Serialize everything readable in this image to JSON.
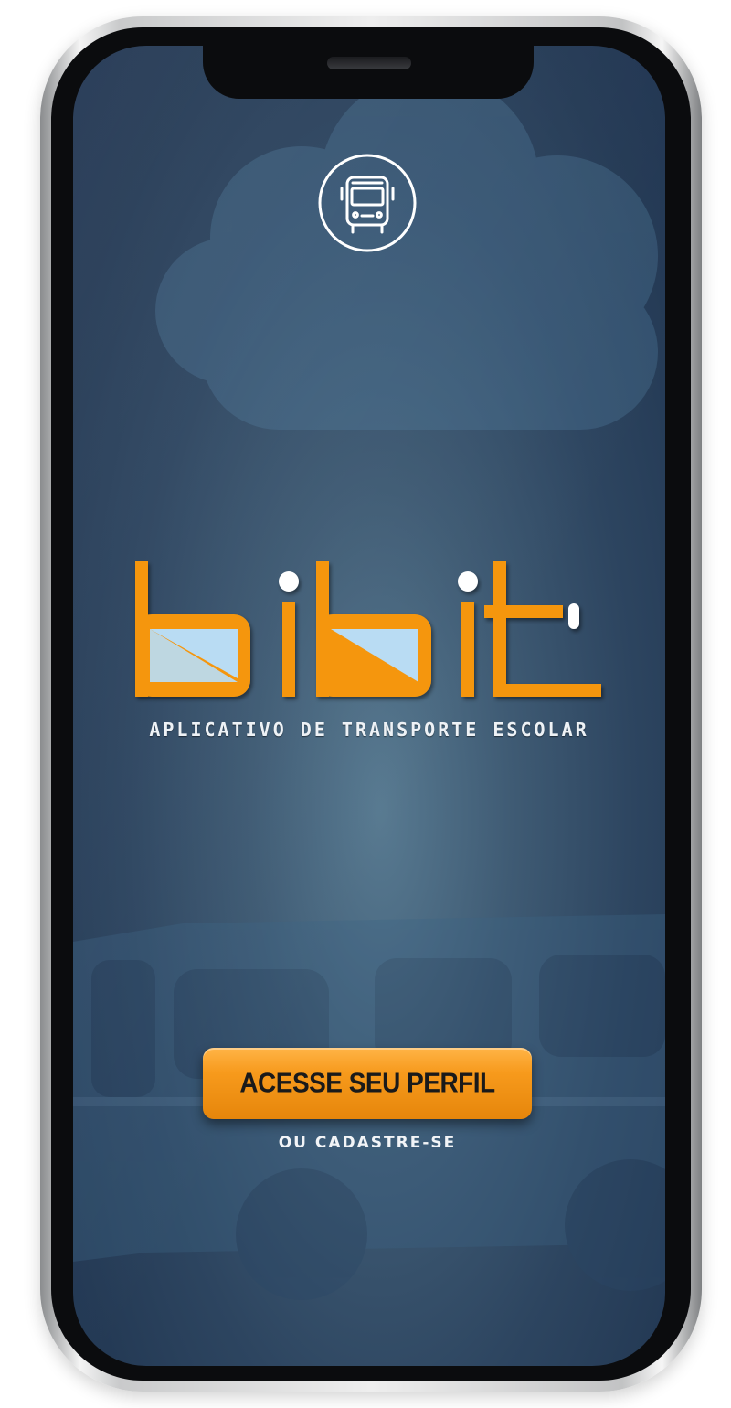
{
  "app": {
    "brand": "bibit",
    "tagline": "APLICATIVO DE TRANSPORTE ESCOLAR"
  },
  "actions": {
    "primary_label": "ACESSE SEU PERFIL",
    "secondary_label": "OU CADASTRE-SE"
  },
  "icons": {
    "top_badge": "bus-front-icon"
  },
  "colors": {
    "accent": "#F5960F",
    "window_fill": "#B9DCF3",
    "text": "#FFFFFF"
  }
}
